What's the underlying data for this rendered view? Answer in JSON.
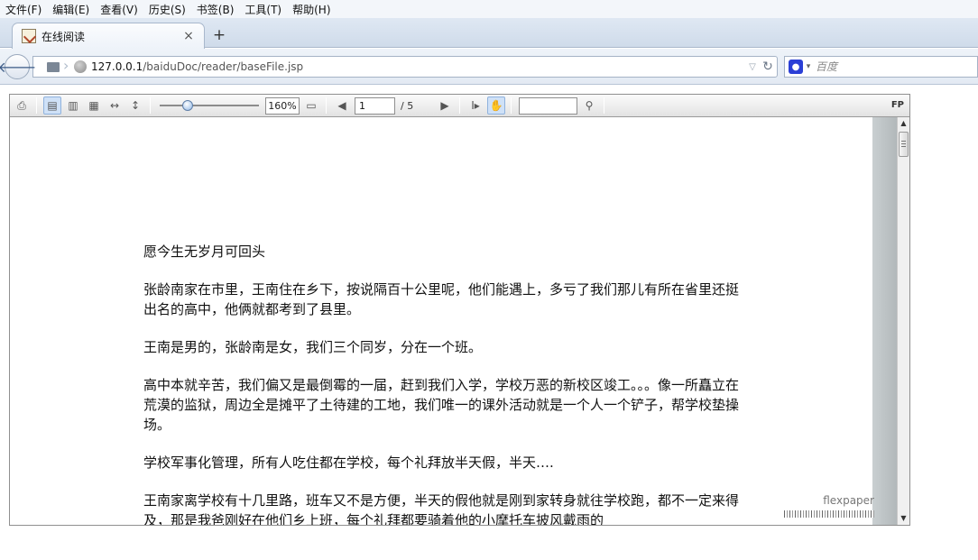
{
  "menu": [
    {
      "label": "文件(F)"
    },
    {
      "label": "编辑(E)"
    },
    {
      "label": "查看(V)"
    },
    {
      "label": "历史(S)"
    },
    {
      "label": "书签(B)"
    },
    {
      "label": "工具(T)"
    },
    {
      "label": "帮助(H)"
    }
  ],
  "tab": {
    "title": "在线阅读",
    "close": "×",
    "new_tab": "+"
  },
  "nav": {
    "url_host": "127.0.0.1",
    "url_path": "/baiduDoc/reader/baseFile.jsp",
    "search_placeholder": "百度"
  },
  "viewer": {
    "zoom": "160%",
    "page_current": "1",
    "page_total": "/ 5",
    "fp_label": "FP",
    "brand": "flexpaper"
  },
  "document": {
    "paragraphs": [
      "愿今生无岁月可回头",
      "张龄南家在市里，王南住在乡下，按说隔百十公里呢，他们能遇上，多亏了我们那儿有所在省里还挺出名的高中，他俩就都考到了县里。",
      "王南是男的，张龄南是女，我们三个同岁，分在一个班。",
      "高中本就辛苦，我们偏又是最倒霉的一届，赶到我们入学，学校万恶的新校区竣工。。。像一所矗立在荒漠的监狱，周边全是摊平了土待建的工地，我们唯一的课外活动就是一个人一个铲子，帮学校垫操场。",
      "学校军事化管理，所有人吃住都在学校，每个礼拜放半天假，半天….",
      "王南家离学校有十几里路，班车又不是方便，半天的假他就是刚到家转身就往学校跑，都不一定来得及，那是我爸刚好在他们乡上班，每个礼拜都要骑着他的小摩托车披风戴雨的"
    ]
  }
}
